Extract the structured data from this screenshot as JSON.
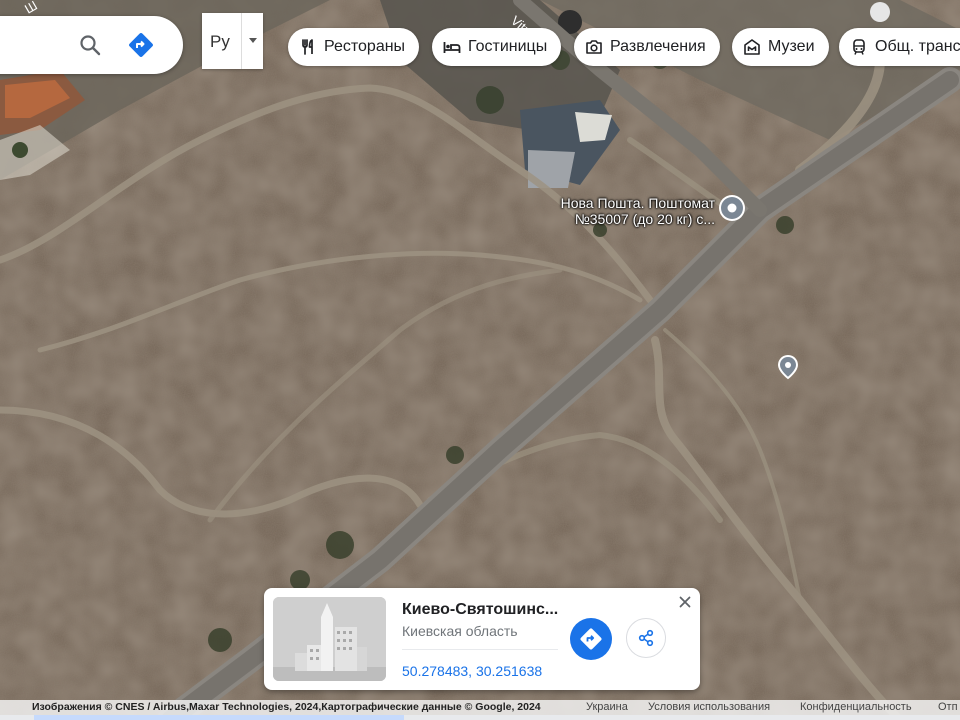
{
  "search": {
    "search_icon": "search-icon",
    "directions_icon": "directions-icon",
    "directions_color": "#1a73e8"
  },
  "language": {
    "selected": "Ру",
    "caret_icon": "caret-down-icon"
  },
  "chips": [
    {
      "label": "Рестораны",
      "icon": "restaurant-icon"
    },
    {
      "label": "Гостиницы",
      "icon": "hotel-icon"
    },
    {
      "label": "Развлечения",
      "icon": "camera-icon"
    },
    {
      "label": "Музеи",
      "icon": "museum-icon"
    },
    {
      "label": "Общ. трансп",
      "icon": "transit-icon"
    }
  ],
  "map": {
    "road_label": "Vitr",
    "road_label_2": "Ш",
    "poi": {
      "line1": "Нова Пошта. Поштомат",
      "line2": "№35007 (до 20 кг) с...",
      "icon": "location-pin-icon"
    },
    "dropped_pin_icon": "location-pin-icon"
  },
  "place_card": {
    "title": "Киево-Святошинс...",
    "subtitle": "Киевская область",
    "coordinates": "50.278483, 30.251638",
    "directions_icon": "directions-icon",
    "share_icon": "share-icon",
    "close_icon": "close-icon",
    "accent": "#1a73e8"
  },
  "attribution": {
    "imagery": "Изображения © CNES / Airbus,Maxar Technologies, 2024,Картографические данные © Google, 2024",
    "country": "Украина",
    "terms": "Условия использования",
    "privacy": "Конфиденциальность",
    "feedback": "Отп"
  }
}
